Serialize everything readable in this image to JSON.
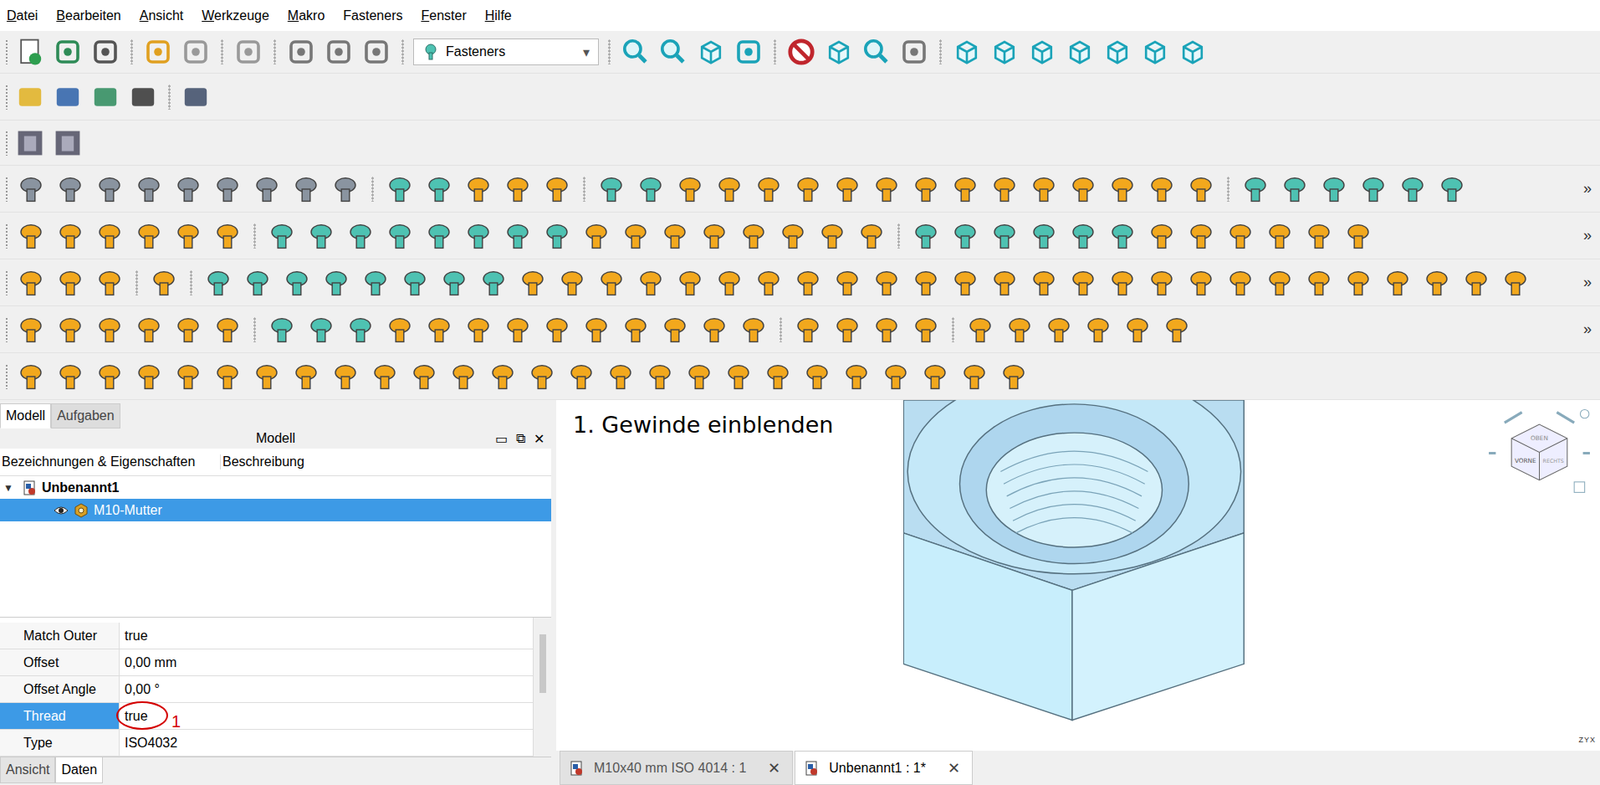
{
  "menu": [
    {
      "label": "Datei",
      "mnemonic": true
    },
    {
      "label": "Bearbeiten",
      "mnemonic": true
    },
    {
      "label": "Ansicht",
      "mnemonic": true
    },
    {
      "label": "Werkzeuge",
      "mnemonic": true
    },
    {
      "label": "Makro",
      "mnemonic": true
    },
    {
      "label": "Fasteners",
      "mnemonic": false
    },
    {
      "label": "Fenster",
      "mnemonic": true
    },
    {
      "label": "Hilfe",
      "mnemonic": true
    }
  ],
  "workbench": {
    "label": "Fasteners",
    "arrow": "▾"
  },
  "toolbar_overflow": "»",
  "panel": {
    "tabs": [
      {
        "label": "Modell",
        "selected": true
      },
      {
        "label": "Aufgaben",
        "selected": false
      }
    ],
    "title": "Modell",
    "close": "✕",
    "columns": [
      "Bezeichnungen & Eigenschaften",
      "Beschreibung"
    ]
  },
  "tree": [
    {
      "label": "Unbenannt1",
      "level": 0,
      "expanded": true,
      "toggle": "▼",
      "selected": false,
      "bold": true
    },
    {
      "label": "M10-Mutter",
      "level": 1,
      "expanded": false,
      "toggle": "",
      "selected": true,
      "bold": false
    }
  ],
  "properties": [
    {
      "name": "Match Outer",
      "value": "true",
      "selected": false,
      "marked": false
    },
    {
      "name": "Offset",
      "value": "0,00 mm",
      "selected": false,
      "marked": false
    },
    {
      "name": "Offset Angle",
      "value": "0,00 °",
      "selected": false,
      "marked": false
    },
    {
      "name": "Thread",
      "value": "true",
      "selected": true,
      "marked": true
    },
    {
      "name": "Type",
      "value": "ISO4032",
      "selected": false,
      "marked": false
    }
  ],
  "annotation": {
    "title": "1. Gewinde einblenden",
    "marker": "1"
  },
  "property_tabs": [
    {
      "label": "Ansicht",
      "selected": false
    },
    {
      "label": "Daten",
      "selected": true
    }
  ],
  "nav_cube": [
    "OBEN",
    "VORNE",
    "RECHTS"
  ],
  "axes": [
    "Z",
    "Y",
    "X"
  ],
  "documents": [
    {
      "label": "M10x40 mm ISO 4014 : 1",
      "selected": false,
      "close": "✕"
    },
    {
      "label": "Unbenannt1 : 1*",
      "selected": true,
      "close": "✕"
    }
  ]
}
